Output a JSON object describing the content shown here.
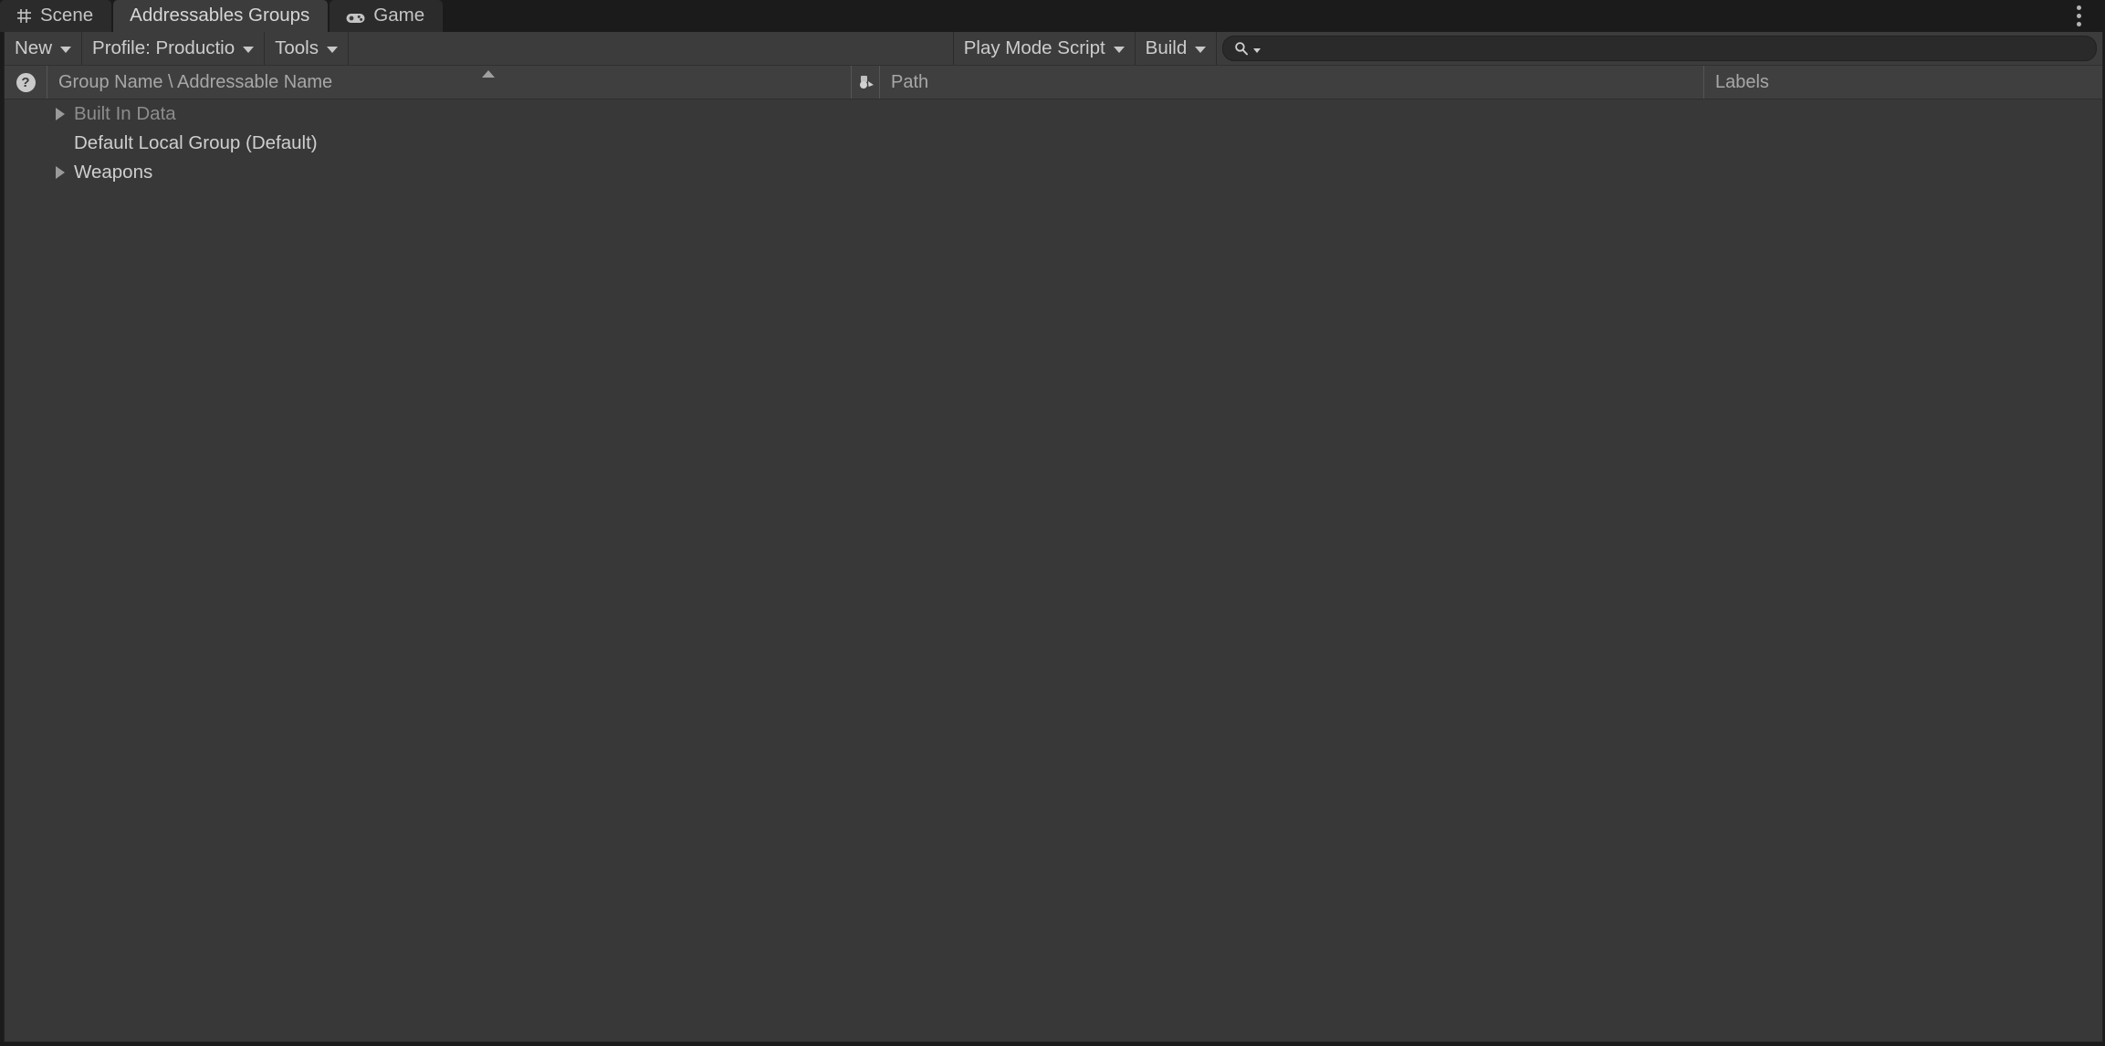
{
  "window": {
    "tabs": [
      {
        "label": "Scene",
        "icon": "grid-icon",
        "active": false
      },
      {
        "label": "Addressables Groups",
        "icon": "none",
        "active": true
      },
      {
        "label": "Game",
        "icon": "gamepad-icon",
        "active": false
      }
    ],
    "options_menu_icon": "kebab-menu-icon"
  },
  "toolbar": {
    "new_label": "New",
    "profile_label": "Profile: Productio",
    "tools_label": "Tools",
    "play_mode_script_label": "Play Mode Script",
    "build_label": "Build",
    "search": {
      "value": "",
      "placeholder": "",
      "icon": "search-icon"
    }
  },
  "columns": {
    "help_icon": "help-icon",
    "help_glyph": "?",
    "group_name": "Group Name \\ Addressable Name",
    "sort_indicator": "sort-ascending-icon",
    "path_icon": "asset-object-icon",
    "path": "Path",
    "labels": "Labels"
  },
  "tree": {
    "rows": [
      {
        "label": "Built In Data",
        "expandable": true,
        "dim": true
      },
      {
        "label": "Default Local Group (Default)",
        "expandable": false,
        "dim": false
      },
      {
        "label": "Weapons",
        "expandable": true,
        "dim": false
      }
    ]
  },
  "colors": {
    "window_bg": "#1b1b1b",
    "panel_bg": "#383838",
    "toolbar_bg": "#3c3c3c",
    "header_bg": "#3f3f3f",
    "tab_active_bg": "#3c3c3c",
    "tab_inactive_bg": "#2b2b2b",
    "text": "#cfcfcf",
    "text_dim": "#8d8d8d"
  }
}
